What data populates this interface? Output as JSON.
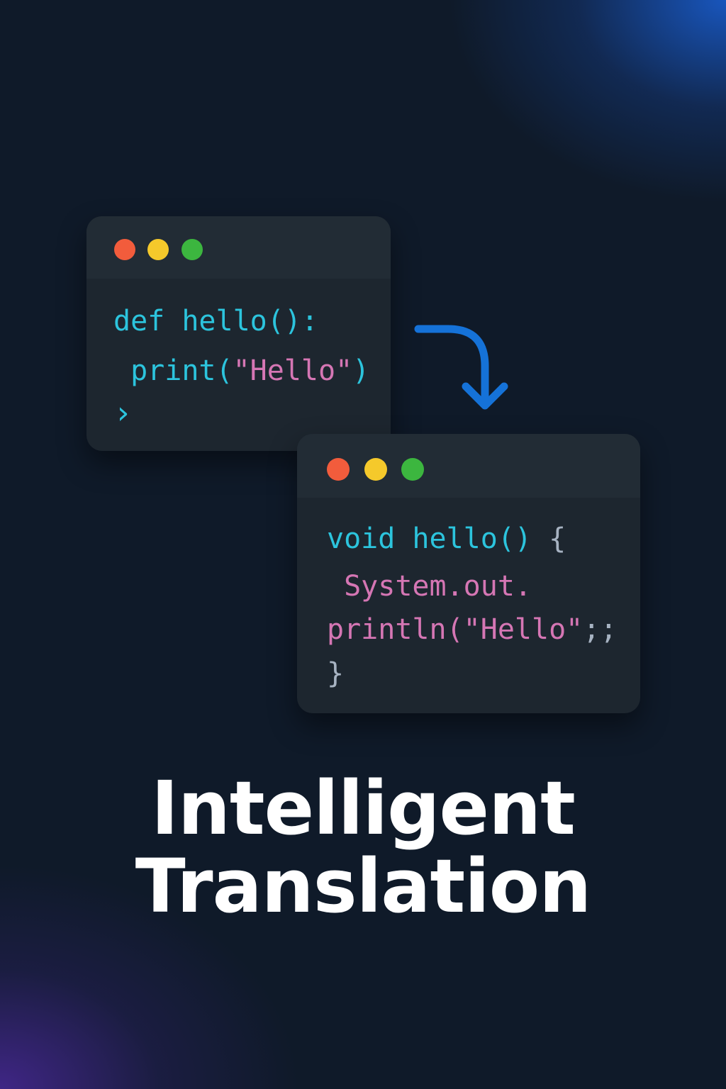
{
  "colors": {
    "dot_red": "#f25c3c",
    "dot_yellow": "#f5c92b",
    "dot_green": "#3cb63f",
    "keyword": "#2cc4dd",
    "string": "#d576b4",
    "arrow": "#1572d8",
    "title": "#ffffff"
  },
  "source_window": {
    "line1": "def hello():",
    "line2_fn": " print(",
    "line2_str": "\"Hello\"",
    "line2_end": ")",
    "prompt": "›"
  },
  "target_window": {
    "line1_kw": "void hello()",
    "line1_brace": " {",
    "line2": " System.out.",
    "line3_str": "println(\"Hello\"",
    "line3_end": ";;",
    "line4": "}"
  },
  "arrow_icon": "curved-arrow-down-icon",
  "heading": {
    "line1": "Intelligent",
    "line2": "Translation"
  }
}
